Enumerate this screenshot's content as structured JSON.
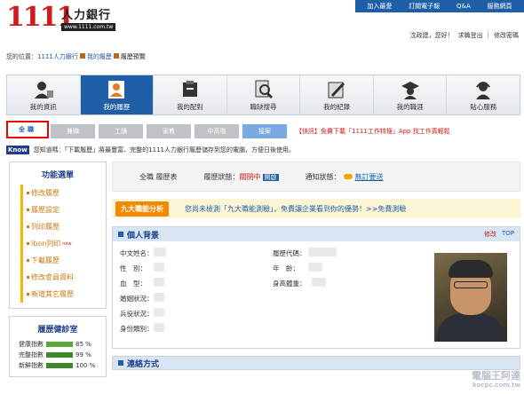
{
  "top_links": [
    "加入最愛",
    "訂閱電子報",
    "Q&A",
    "服務網頁"
  ],
  "logo": {
    "number": "1111",
    "name": "人力銀行",
    "url": "www.1111.com.tw"
  },
  "userbar": {
    "greeting": "沈政建，您好！",
    "logout": "求職登出",
    "sep": "|",
    "edit_pw": "修改密碼"
  },
  "breadcrumb": {
    "prefix": "您的位置：",
    "home": "1111人力銀行",
    "section": "我的履歷",
    "current": "履歷預覽"
  },
  "nav": [
    {
      "label": "我的資訊",
      "icon": "person-info-icon"
    },
    {
      "label": "我的履歷",
      "icon": "resume-person-icon",
      "active": true
    },
    {
      "label": "我的配對",
      "icon": "folder-match-icon"
    },
    {
      "label": "職缺搜尋",
      "icon": "magnifier-search-icon"
    },
    {
      "label": "我的紀錄",
      "icon": "pencil-note-icon"
    },
    {
      "label": "我的職涯",
      "icon": "graduate-cap-icon"
    },
    {
      "label": "貼心服務",
      "icon": "headset-service-icon"
    }
  ],
  "tabs": [
    {
      "label": "全職",
      "style": "active"
    },
    {
      "label": "兼職",
      "style": "grey"
    },
    {
      "label": "工讀",
      "style": "grey"
    },
    {
      "label": "家教",
      "style": "grey"
    },
    {
      "label": "中高階",
      "style": "grey"
    },
    {
      "label": "接案",
      "style": "blue"
    }
  ],
  "promo": "【快訊】免費下載「1111工作特搜」App 找工作真輕鬆",
  "notice": {
    "badge": "Know",
    "text": "您知道嗎：「下載履歷」將最豐富、完整的1111人力銀行履歷儲存到您的電腦，方便日後使用。"
  },
  "sidebar": {
    "title": "功能選單",
    "items": [
      {
        "label": "修改履歷"
      },
      {
        "label": "履歷設定"
      },
      {
        "label": "列印履歷"
      },
      {
        "label": "ibon列印",
        "badge": "new"
      },
      {
        "label": "下載履歷"
      },
      {
        "label": "修改會員資料"
      },
      {
        "label": "新增其它履歷"
      }
    ],
    "clinic_title": "履歷健診室",
    "meters": [
      {
        "label": "健康指數",
        "value": "85 %"
      },
      {
        "label": "完整指數",
        "value": "99 %"
      },
      {
        "label": "新鮮指數",
        "value": "100 %"
      }
    ]
  },
  "status": {
    "type": "全職 履歷表",
    "status_label": "履歷狀態：",
    "status_value": "關閉中",
    "open_label": "開啟",
    "notify_label": "通知狀態：",
    "notify_value": "無訂要送"
  },
  "analysis": {
    "button": "九大職能分析",
    "text": "您尚未檢測「九大職能測驗」，免費讓企業看到你的優勢！",
    "link": ">>免費測驗"
  },
  "personal": {
    "title": "個人背景",
    "edit": "修改",
    "top": "TOP",
    "fields_left": [
      "中文姓名：",
      "性　別：",
      "血　型：",
      "婚姻狀況：",
      "兵役狀況：",
      "身份類別："
    ],
    "fields_right": [
      "履歷代碼：",
      "年　齡：",
      "身高體重："
    ]
  },
  "contact": {
    "title": "連絡方式"
  },
  "watermark": {
    "line1": "電腦王阿達",
    "line2": "kocpc.com.tw"
  }
}
